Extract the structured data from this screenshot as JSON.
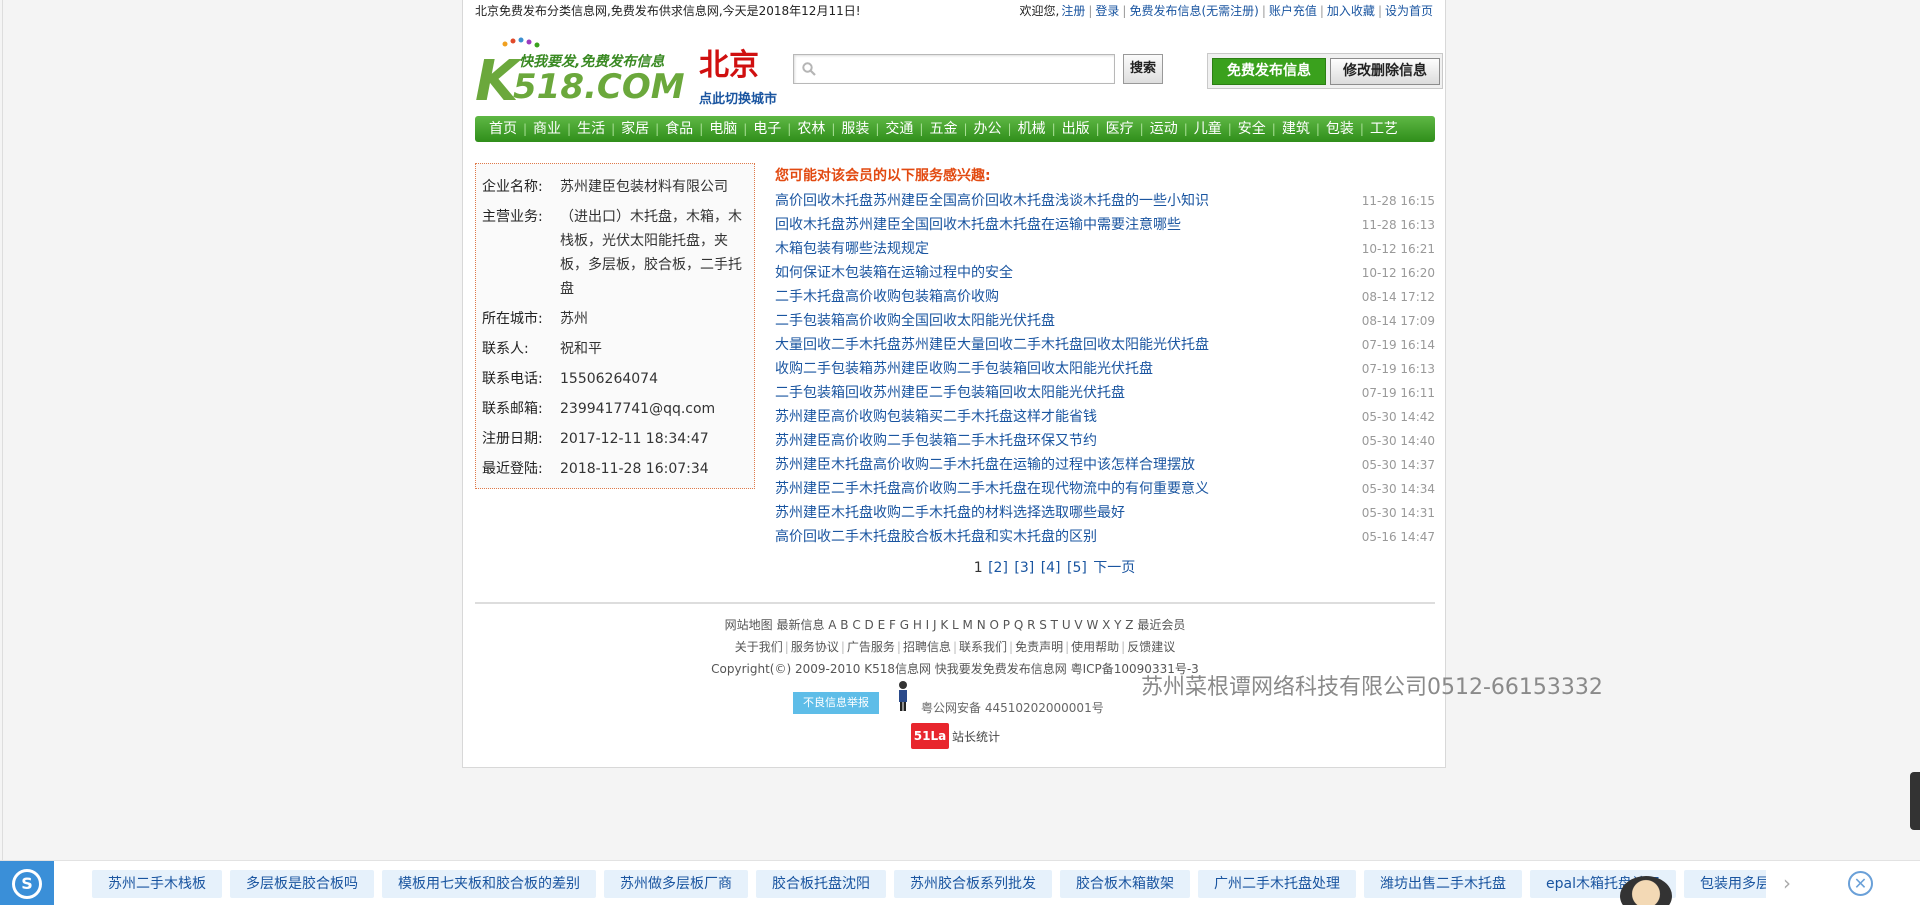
{
  "topbar": {
    "notice": "北京免费发布分类信息网,免费发布供求信息网,今天是2018年12月11日!",
    "welcome": "欢迎您,",
    "links": [
      "注册",
      "登录",
      "免费发布信息(无需注册)",
      "账户充值",
      "加入收藏",
      "设为首页"
    ]
  },
  "header": {
    "logo_slogan": "快我要发,免费发布信息",
    "logo_text": "K518.COM",
    "city": "北京",
    "switch_city": "点此切换城市",
    "search_value": "",
    "search_button": "搜索",
    "post_button": "免费发布信息",
    "edit_button": "修改删除信息"
  },
  "nav": [
    "首页",
    "商业",
    "生活",
    "家居",
    "食品",
    "电脑",
    "电子",
    "农林",
    "服装",
    "交通",
    "五金",
    "办公",
    "机械",
    "出版",
    "医疗",
    "运动",
    "儿童",
    "安全",
    "建筑",
    "包装",
    "工艺"
  ],
  "company": {
    "rows": [
      {
        "k": "企业名称:",
        "v": "苏州建臣包装材料有限公司"
      },
      {
        "k": "主营业务:",
        "v": "（进出口）木托盘，木箱，木栈板，光伏太阳能托盘，夹板，多层板，胶合板，二手托盘"
      },
      {
        "k": "所在城市:",
        "v": "苏州"
      },
      {
        "k": "联系人:",
        "v": "祝和平"
      },
      {
        "k": "联系电话:",
        "v": "15506264074"
      },
      {
        "k": "联系邮箱:",
        "v": "2399417741@qq.com"
      },
      {
        "k": "注册日期:",
        "v": "2017-12-11 18:34:47"
      },
      {
        "k": "最近登陆:",
        "v": "2018-11-28 16:07:34"
      }
    ]
  },
  "list": {
    "title": "您可能对该会员的以下服务感兴趣:",
    "items": [
      {
        "text": "高价回收木托盘苏州建臣全国高价回收木托盘浅谈木托盘的一些小知识",
        "time": "11-28 16:15"
      },
      {
        "text": "回收木托盘苏州建臣全国回收木托盘木托盘在运输中需要注意哪些",
        "time": "11-28 16:13"
      },
      {
        "text": "木箱包装有哪些法规规定",
        "time": "10-12 16:21"
      },
      {
        "text": "如何保证木包装箱在运输过程中的安全",
        "time": "10-12 16:20"
      },
      {
        "text": "二手木托盘高价收购包装箱高价收购",
        "time": "08-14 17:12"
      },
      {
        "text": "二手包装箱高价收购全国回收太阳能光伏托盘",
        "time": "08-14 17:09"
      },
      {
        "text": "大量回收二手木托盘苏州建臣大量回收二手木托盘回收太阳能光伏托盘",
        "time": "07-19 16:14"
      },
      {
        "text": "收购二手包装箱苏州建臣收购二手包装箱回收太阳能光伏托盘",
        "time": "07-19 16:13"
      },
      {
        "text": "二手包装箱回收苏州建臣二手包装箱回收太阳能光伏托盘",
        "time": "07-19 16:11"
      },
      {
        "text": "苏州建臣高价收购包装箱买二手木托盘这样才能省钱",
        "time": "05-30 14:42"
      },
      {
        "text": "苏州建臣高价收购二手包装箱二手木托盘环保又节约",
        "time": "05-30 14:40"
      },
      {
        "text": "苏州建臣木托盘高价收购二手木托盘在运输的过程中该怎样合理摆放",
        "time": "05-30 14:37"
      },
      {
        "text": "苏州建臣二手木托盘高价收购二手木托盘在现代物流中的有何重要意义",
        "time": "05-30 14:34"
      },
      {
        "text": "苏州建臣木托盘收购二手木托盘的材料选择选取哪些最好",
        "time": "05-30 14:31"
      },
      {
        "text": "高价回收二手木托盘胶合板木托盘和实木托盘的区别",
        "time": "05-16 14:47"
      }
    ],
    "pager": {
      "current": "1",
      "pages": [
        "[2]",
        "[3]",
        "[4]",
        "[5]"
      ],
      "next": "下一页"
    }
  },
  "footer": {
    "line1": "网站地图 最新信息 A B C D E F G H I J K L M N O P Q R S T U V W X Y Z  最近会员",
    "links": [
      "关于我们",
      "服务协议",
      "广告服务",
      "招聘信息",
      "联系我们",
      "免责声明",
      "使用帮助",
      "反馈建议"
    ],
    "copyright": "Copyright(©) 2009-2010 K518信息网 快我要发免费发布信息网 粤ICP备10090331号-3",
    "report": "不良信息举报",
    "gongan": "粤公网安备 44510202000001号",
    "la_badge": "51La",
    "la_text": "站长统计"
  },
  "watermark": "苏州菜根谭网络科技有限公司0512-66153332",
  "bottombar": {
    "tags": [
      "苏州二手木栈板",
      "多层板是胶合板吗",
      "模板用七夹板和胶合板的差别",
      "苏州做多层板厂商",
      "胶合板托盘沈阳",
      "苏州胶合板系列批发",
      "胶合板木箱散架",
      "广州二手木托盘处理",
      "潍坊出售二手木托盘",
      "epal木箱托盘认识",
      "包装用多层板"
    ]
  },
  "colors": {
    "nav_green": "#3a9d24",
    "accent_red": "#d01010",
    "title_orange": "#e24a11",
    "link_blue": "#1a55a0"
  }
}
